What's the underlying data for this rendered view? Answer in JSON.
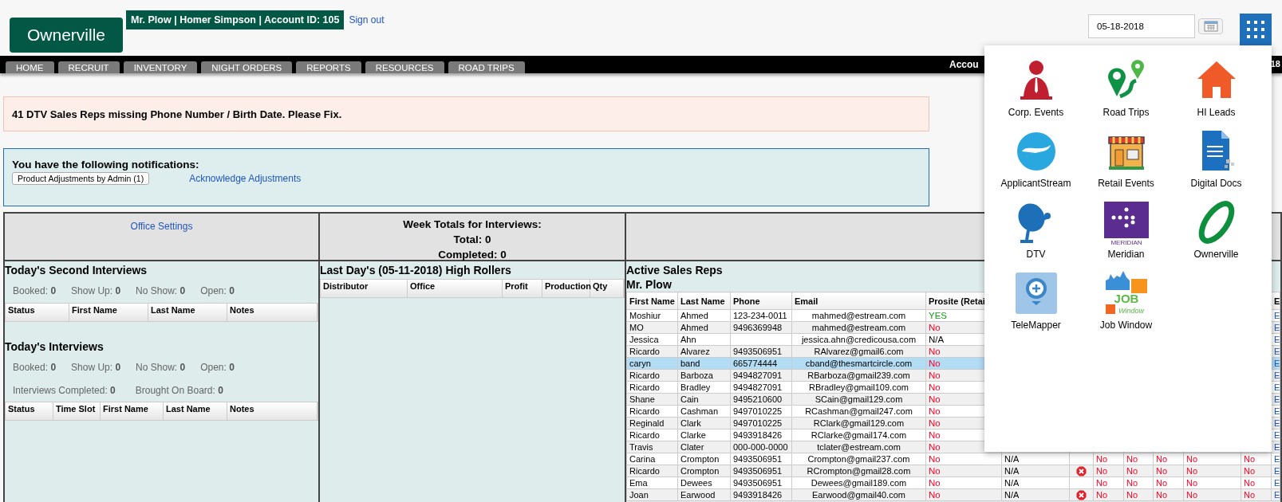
{
  "logo": "Ownerville",
  "user_banner": "Mr. Plow | Homer Simpson | Account ID: 105",
  "sign_out": "Sign out",
  "date_field": {
    "value": "05-18-2018"
  },
  "nav": {
    "tabs": [
      "HOME",
      "RECRUIT",
      "INVENTORY",
      "NIGHT ORDERS",
      "REPORTS",
      "RESOURCES",
      "ROAD TRIPS"
    ],
    "left_fragment": "Accou",
    "right_fragment": "18"
  },
  "alert": "41 DTV Sales Reps missing Phone Number / Birth Date. Please Fix.",
  "notifications": {
    "title": "You have the following notifications:",
    "button": "Product Adjustments by Admin (1)",
    "link": "Acknowledge Adjustments"
  },
  "office_settings": "Office Settings",
  "week_totals": [
    "Week Totals for Interviews:",
    "Total: 0",
    "Completed: 0"
  ],
  "second_interviews": {
    "title": "Today's Second Interviews",
    "stats": [
      {
        "label": "Booked:",
        "value": "0"
      },
      {
        "label": "Show Up:",
        "value": "0"
      },
      {
        "label": "No Show:",
        "value": "0"
      },
      {
        "label": "Open:",
        "value": "0"
      }
    ],
    "columns": [
      "Status",
      "First Name",
      "Last Name",
      "Notes"
    ]
  },
  "interviews": {
    "title": "Today's Interviews",
    "stats": [
      {
        "label": "Booked:",
        "value": "0"
      },
      {
        "label": "Show Up:",
        "value": "0"
      },
      {
        "label": "No Show:",
        "value": "0"
      },
      {
        "label": "Open:",
        "value": "0"
      }
    ],
    "stats_2": [
      {
        "label": "Interviews Completed:",
        "value": "0"
      },
      {
        "label": "Brought On Board:",
        "value": "0"
      }
    ],
    "columns": [
      "Status",
      "Time Slot",
      "First Name",
      "Last Name",
      "Notes"
    ]
  },
  "high_rollers": {
    "title": "Last Day's (05-11-2018) High Rollers",
    "columns": [
      "Distributor",
      "Office",
      "Profit",
      "Production",
      "Qty"
    ]
  },
  "sales_reps": {
    "title": "Active Sales Reps",
    "subtitle": "Mr. Plow",
    "columns": [
      "First Name",
      "Last Name",
      "Phone",
      "Email",
      "Prosite (Retai"
    ],
    "last_column": "E",
    "rows": [
      {
        "first": "Moshiur",
        "last": "Ahmed",
        "phone": "123-234-0011",
        "email": "mahmed@estream.com",
        "prosite": {
          "text": "YES",
          "color": "#1a9a1a"
        },
        "selected": false,
        "column_13": "E"
      },
      {
        "first": "MO",
        "last": "Ahmed",
        "phone": "9496369948",
        "email": "mahmed@estream.com",
        "prosite": {
          "text": "No",
          "color": "#ff0022"
        },
        "selected": false,
        "column_13": "E"
      },
      {
        "first": "Jessica",
        "last": "Ahn",
        "email": "jessica.ahn@credicousa.com",
        "prosite": {
          "text": "N/A",
          "color": "#000000"
        },
        "selected": false,
        "column_13": "E"
      },
      {
        "first": "Ricardo",
        "last": "Alvarez",
        "phone": "9493506951",
        "email": "RAlvarez@gmail6.com",
        "prosite": {
          "text": "No",
          "color": "#ff0022"
        },
        "selected": false,
        "column_13": "E"
      },
      {
        "first": "caryn",
        "last": "band",
        "phone": "665774444",
        "email": "cband@thesmartcircle.com",
        "prosite": {
          "text": "No",
          "color": "#ff0022"
        },
        "selected": true,
        "column_13": "E"
      },
      {
        "first": "Ricardo",
        "last": "Barboza",
        "phone": "9494827091",
        "email": "RBarboza@gmail239.com",
        "prosite": {
          "text": "No",
          "color": "#ff0022"
        },
        "selected": false,
        "column_13": "E"
      },
      {
        "first": "Ricardo",
        "last": "Bradley",
        "phone": "9494827091",
        "email": "RBradley@gmail109.com",
        "prosite": {
          "text": "No",
          "color": "#ff0022"
        },
        "selected": false,
        "column_13": "E"
      },
      {
        "first": "Shane",
        "last": "Cain",
        "phone": "9495210600",
        "email": "SCain@gmail129.com",
        "prosite": {
          "text": "No",
          "color": "#ff0022"
        },
        "selected": false,
        "column_13": "E"
      },
      {
        "first": "Ricardo",
        "last": "Cashman",
        "phone": "9497010225",
        "email": "RCashman@gmail247.com",
        "prosite": {
          "text": "No",
          "color": "#ff0022"
        },
        "selected": false,
        "column_13": "E"
      },
      {
        "first": "Reginald",
        "last": "Clark",
        "phone": "9497010225",
        "email": "RClark@gmail129.com",
        "prosite": {
          "text": "No",
          "color": "#ff0022"
        },
        "selected": false,
        "column_13": "E"
      },
      {
        "first": "Ricardo",
        "last": "Clarke",
        "phone": "9493918426",
        "email": "RClarke@gmail174.com",
        "prosite": {
          "text": "No",
          "color": "#ff0022"
        },
        "selected": false,
        "column_13": "E"
      },
      {
        "first": "Travis",
        "last": "Clater",
        "phone": "000-000-0000",
        "email": "tclater@estream.com",
        "prosite": {
          "text": "No",
          "color": "#ff0022"
        },
        "selected": false,
        "column_13": "E"
      },
      {
        "first": "Carina",
        "last": "Crompton",
        "phone": "9493506951",
        "email": "Crompton@gmail237.com",
        "prosite": {
          "text": "No",
          "color": "#ff0022"
        },
        "selected": false,
        "column_6": "N/A",
        "error_icon": false,
        "no_columns": [
          "No",
          "No",
          "No",
          "No",
          "No"
        ],
        "column_13": "E"
      },
      {
        "first": "Ricardo",
        "last": "Crompton",
        "phone": "9493506951",
        "email": "RCrompton@gmail28.com",
        "prosite": {
          "text": "No",
          "color": "#ff0022"
        },
        "selected": false,
        "column_6": "N/A",
        "error_icon": true,
        "no_columns": [
          "No",
          "No",
          "No",
          "No",
          "No"
        ],
        "column_13": "E"
      },
      {
        "first": "Ema",
        "last": "Dewees",
        "phone": "9493506951",
        "email": "Dewees@gmail189.com",
        "prosite": {
          "text": "No",
          "color": "#ff0022"
        },
        "selected": false,
        "column_6": "N/A",
        "error_icon": false,
        "no_columns": [
          "No",
          "No",
          "No",
          "No",
          "No"
        ],
        "column_13": "E"
      },
      {
        "first": "Joan",
        "last": "Earwood",
        "phone": "9493918426",
        "email": "Earwood@gmail40.com",
        "prosite": {
          "text": "No",
          "color": "#ff0022"
        },
        "selected": false,
        "column_6": "N/A",
        "error_icon": true,
        "no_columns": [
          "No",
          "No",
          "No",
          "No",
          "No"
        ],
        "column_13": "E"
      }
    ]
  },
  "app_menu": {
    "apps": [
      {
        "label": "Corp. Events"
      },
      {
        "label": "Road Trips"
      },
      {
        "label": "HI Leads"
      },
      {
        "label": "ApplicantStream"
      },
      {
        "label": "Retail Events"
      },
      {
        "label": "Digital Docs"
      },
      {
        "label": "DTV"
      },
      {
        "label": "Meridian",
        "logo_text": "MERIDIAN"
      },
      {
        "label": "Ownerville"
      },
      {
        "label": "TeleMapper"
      },
      {
        "label": "Job Window",
        "logo_text": "JOB",
        "logo_subtext": "Window"
      }
    ]
  }
}
